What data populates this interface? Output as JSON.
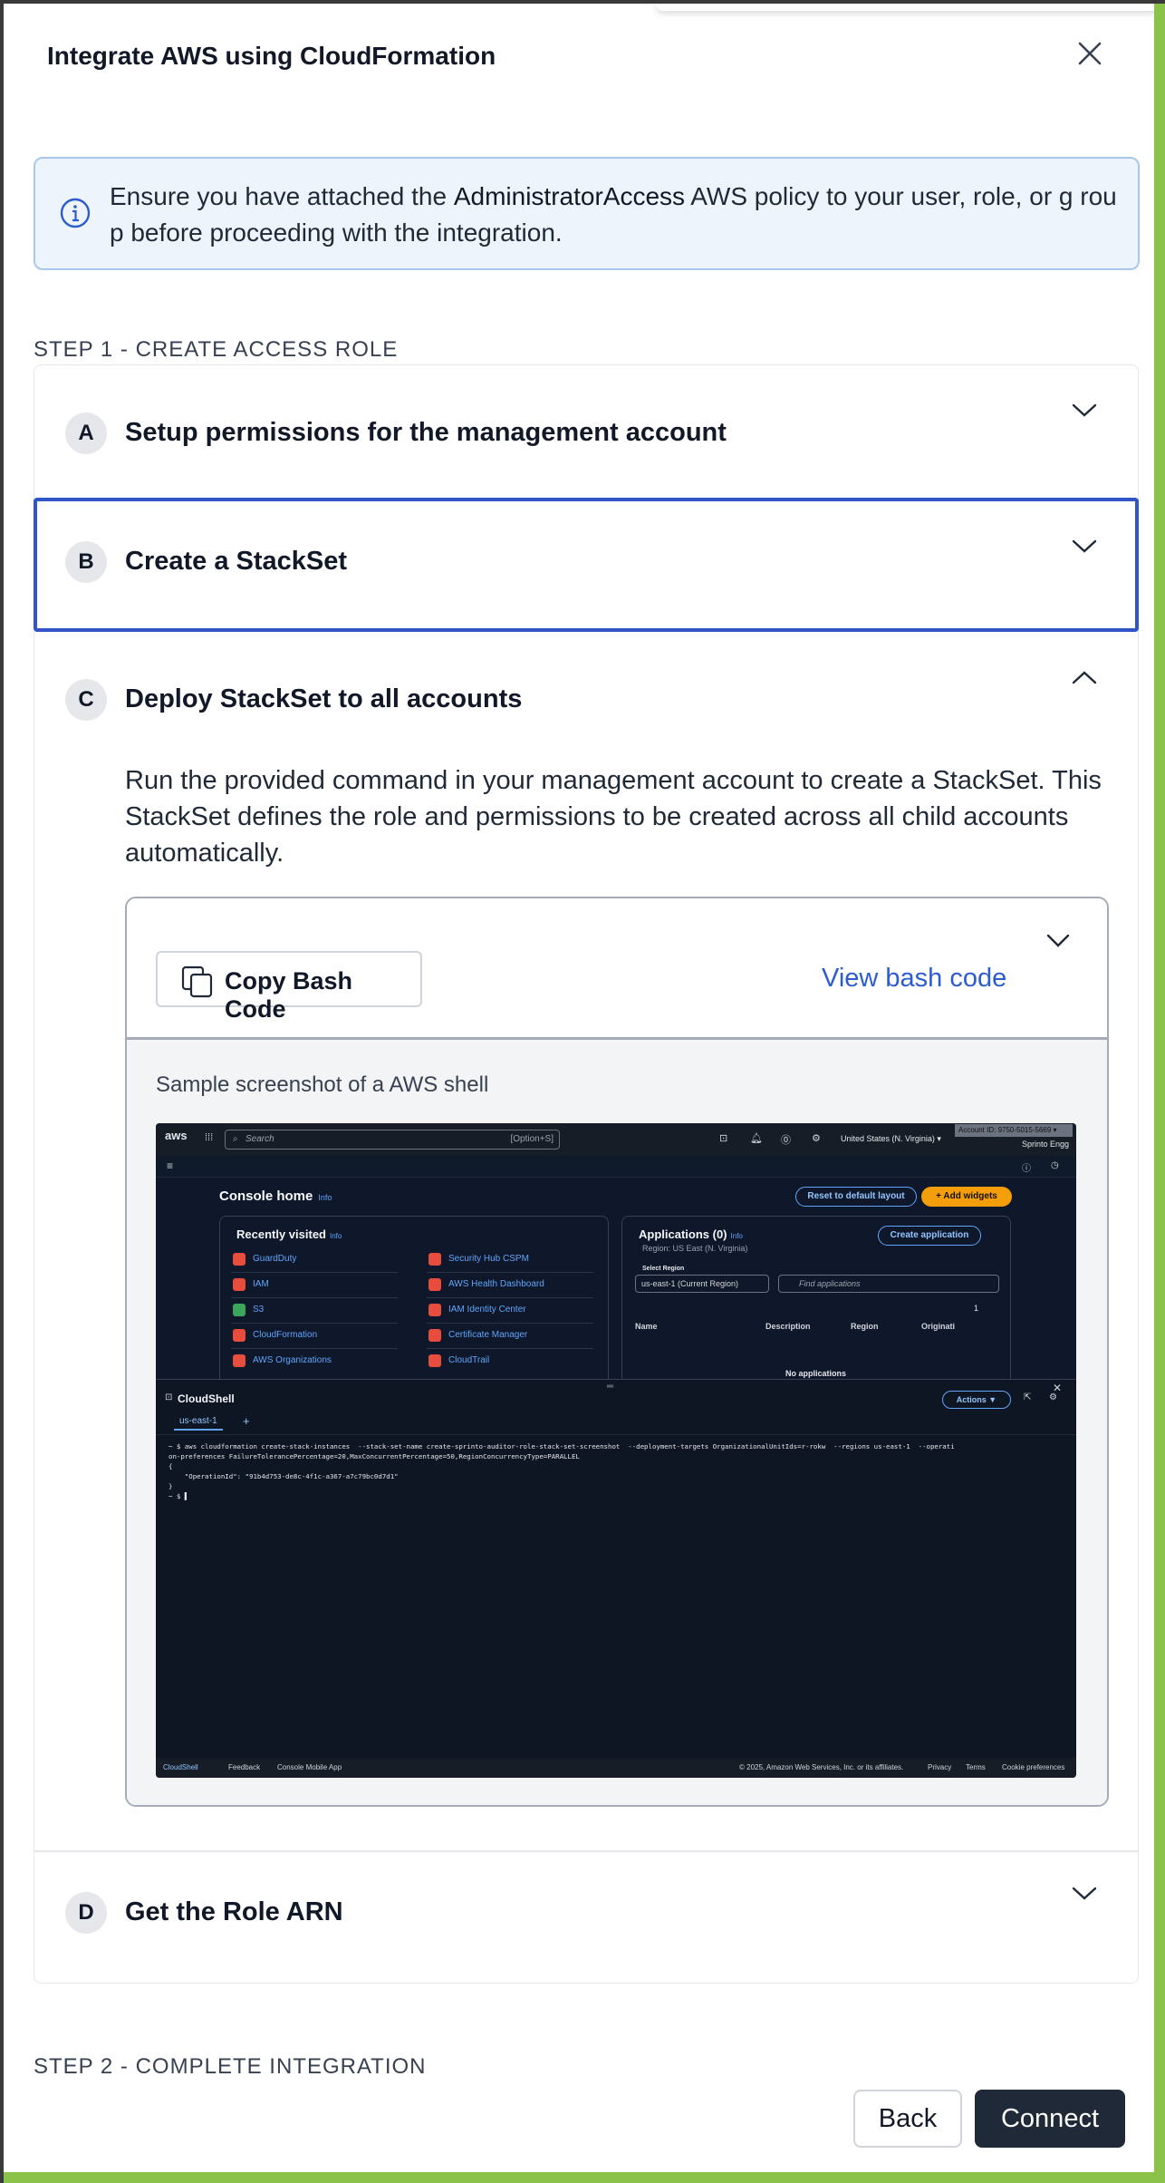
{
  "modal": {
    "title": "Integrate AWS using CloudFormation",
    "close_icon": "close-icon"
  },
  "info": {
    "icon": "info-icon",
    "text_before": "Ensure you have attached the ",
    "text_bold": "AdministratorAccess",
    "text_after": " AWS policy to your user, role, or g roup before proceeding with the integration."
  },
  "step1": {
    "heading": "STEP 1 - CREATE ACCESS ROLE"
  },
  "step2": {
    "heading": "STEP 2 - COMPLETE INTEGRATION"
  },
  "accordion": {
    "items": [
      {
        "letter": "A",
        "title": "Setup permissions for the management account",
        "expanded": false
      },
      {
        "letter": "B",
        "title": "Create a StackSet",
        "expanded": false,
        "focused": true
      },
      {
        "letter": "C",
        "title": "Deploy StackSet to all accounts",
        "expanded": true
      },
      {
        "letter": "D",
        "title": "Get the Role ARN",
        "expanded": false
      }
    ],
    "c_description": "Run the provided command in your management account to create a StackSet. This StackSet defines the role and permissions to be created across all child accounts automatically."
  },
  "code_panel": {
    "copy_label": "Copy Bash Code",
    "copy_icon": "copy-icon",
    "view_link": "View bash code",
    "sample_caption": "Sample screenshot of a AWS shell"
  },
  "aws_shot": {
    "logo": "aws",
    "search_placeholder": "Search",
    "search_shortcut": "[Option+S]",
    "account_id": "Account ID: 9750-5015-5669 ▾",
    "region": "United States (N. Virginia) ▾",
    "user": "Sprinto Engg",
    "console_home": "Console home",
    "info": "Info",
    "reset_layout": "Reset to default layout",
    "add_widgets": "+ Add widgets",
    "recently_visited": "Recently visited",
    "rv_left": [
      "GuardDuty",
      "IAM",
      "S3",
      "CloudFormation",
      "AWS Organizations"
    ],
    "rv_right": [
      "Security Hub CSPM",
      "AWS Health Dashboard",
      "IAM Identity Center",
      "Certificate Manager",
      "CloudTrail"
    ],
    "applications": "Applications (0)",
    "app_region": "Region: US East (N. Virginia)",
    "create_application": "Create application",
    "select_region_label": "Select Region",
    "select_region_value": "us-east-1 (Current Region)",
    "find_apps": "Find applications",
    "page_num": "1",
    "columns": [
      "Name",
      "Description",
      "Region",
      "Originati"
    ],
    "no_apps": "No applications",
    "cloudshell": "CloudShell",
    "actions": "Actions ▼",
    "tab": "us-east-1",
    "terminal": "~ $ aws cloudformation create-stack-instances  --stack-set-name create-sprinto-auditor-role-stack-set-screenshot  --deployment-targets OrganizationalUnitIds=r-rokw  --regions us-east-1  --operati\non-preferences FailureTolerancePercentage=20,MaxConcurrentPercentage=50,RegionConcurrencyType=PARALLEL\n{\n    \"OperationId\": \"91b4d753-de8c-4f1c-a367-a7c79bc0d7d1\"\n}\n~ $ ▌",
    "footer_left": [
      "CloudShell",
      "Feedback",
      "Console Mobile App"
    ],
    "footer_copyright": "© 2025, Amazon Web Services, Inc. or its affiliates.",
    "footer_right": [
      "Privacy",
      "Terms",
      "Cookie preferences"
    ]
  },
  "footer": {
    "back_label": "Back",
    "connect_label": "Connect"
  },
  "colors": {
    "accent": "#2c5ccf",
    "focus": "#2f55c8",
    "primary_btn": "#1f2937",
    "info_bg": "#eef4fc"
  }
}
